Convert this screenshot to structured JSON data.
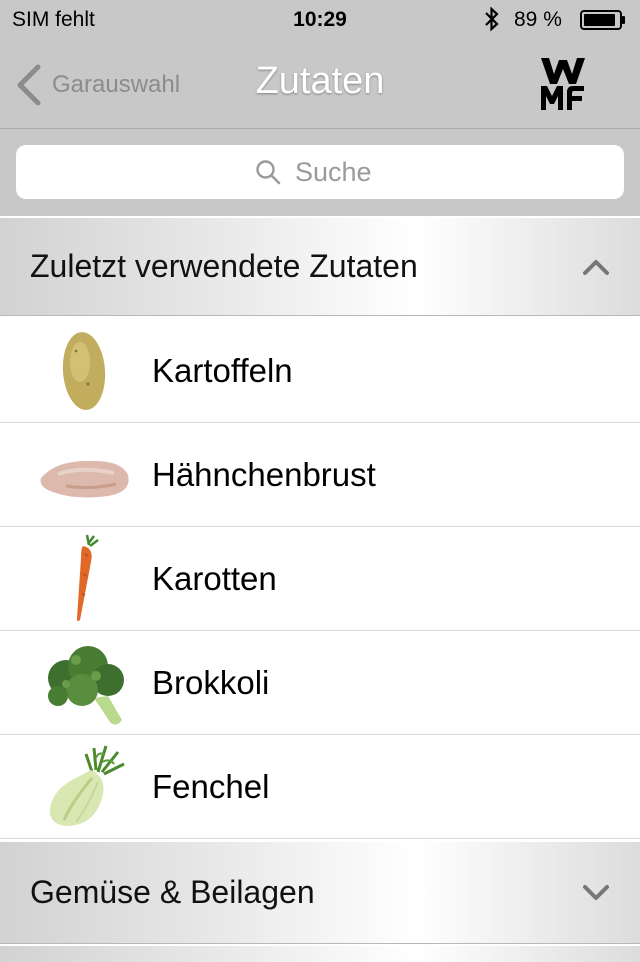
{
  "status_bar": {
    "carrier": "SIM fehlt",
    "time": "10:29",
    "battery": "89 %",
    "icons": [
      "bluetooth-icon",
      "battery-icon"
    ]
  },
  "nav": {
    "back_label": "Garauswahl",
    "title": "Zutaten",
    "logo": "WMF"
  },
  "search": {
    "placeholder": "Suche"
  },
  "sections": [
    {
      "label": "Zuletzt verwendete Zutaten",
      "expanded": true,
      "items": [
        {
          "label": "Kartoffeln",
          "icon": "potato-image"
        },
        {
          "label": "Hähnchenbrust",
          "icon": "chicken-breast-image"
        },
        {
          "label": "Karotten",
          "icon": "carrot-image"
        },
        {
          "label": "Brokkoli",
          "icon": "broccoli-image"
        },
        {
          "label": "Fenchel",
          "icon": "fennel-image"
        }
      ]
    },
    {
      "label": "Gemüse & Beilagen",
      "expanded": false
    }
  ],
  "colors": {
    "bar_background": "#c8c8c8",
    "nav_title": "#ffffff",
    "back_label": "#8c8c8c"
  }
}
